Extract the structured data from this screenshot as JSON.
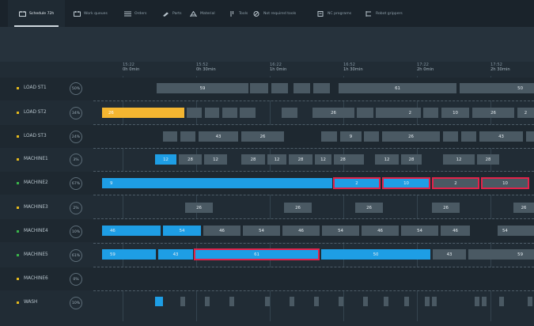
{
  "tabs": [
    {
      "label": "Schedule 72h",
      "icon": "calendar-icon",
      "active": true
    },
    {
      "label": "Work queues",
      "icon": "calendar-icon"
    },
    {
      "label": "Orders",
      "icon": "list-icon"
    },
    {
      "label": "Parts",
      "icon": "wrench-icon"
    },
    {
      "label": "Material",
      "icon": "material-icon"
    },
    {
      "label": "Tools",
      "icon": "tool-icon"
    },
    {
      "label": "Not required tools",
      "icon": "block-icon"
    },
    {
      "label": "NC programs",
      "icon": "nc-program-icon"
    },
    {
      "label": "Robot grippers",
      "icon": "gripper-icon"
    }
  ],
  "time_ticks": [
    {
      "clock": "15:22",
      "offset": "0h 0min"
    },
    {
      "clock": "15:52",
      "offset": "0h 30min"
    },
    {
      "clock": "16:22",
      "offset": "1h 0min"
    },
    {
      "clock": "16:52",
      "offset": "1h 30min"
    },
    {
      "clock": "17:22",
      "offset": "2h 0min"
    },
    {
      "clock": "17:52",
      "offset": "2h 30min"
    }
  ],
  "rows": [
    {
      "label": "LOAD ST1",
      "percent": "50%",
      "bullet": "yellow"
    },
    {
      "label": "LOAD ST2",
      "percent": "34%",
      "bullet": "yellow"
    },
    {
      "label": "LOAD ST3",
      "percent": "24%",
      "bullet": "yellow"
    },
    {
      "label": "MACHINE1",
      "percent": "3%",
      "bullet": "yellow"
    },
    {
      "label": "MACHINE2",
      "percent": "67%",
      "bullet": "green"
    },
    {
      "label": "MACHINE3",
      "percent": "2%",
      "bullet": "yellow"
    },
    {
      "label": "MACHINE4",
      "percent": "10%",
      "bullet": "green"
    },
    {
      "label": "MACHINE5",
      "percent": "61%",
      "bullet": "green"
    },
    {
      "label": "MACHINE6",
      "percent": "0%",
      "bullet": "yellow"
    },
    {
      "label": "WASH",
      "percent": "10%",
      "bullet": "yellow"
    }
  ],
  "blocks": {
    "r0": [
      "59",
      "61",
      "50"
    ],
    "r1": [
      "26",
      "26",
      "2",
      "10",
      "26",
      "2"
    ],
    "r2": [
      "43",
      "26",
      "9",
      "26",
      "43"
    ],
    "r3": [
      "12",
      "28",
      "12",
      "28",
      "12",
      "28",
      "12",
      "28",
      "12",
      "28",
      "12",
      "28"
    ],
    "r4": [
      "9",
      "2",
      "10",
      "2",
      "10"
    ],
    "r5": [
      "26",
      "26",
      "26",
      "26",
      "26"
    ],
    "r6": [
      "46",
      "54",
      "46",
      "54",
      "46",
      "54",
      "46",
      "54",
      "46",
      "54"
    ],
    "r7": [
      "59",
      "43",
      "61",
      "50",
      "43",
      "59"
    ]
  },
  "colors": {
    "background": "#212c35",
    "grey_block": "#4a5963",
    "blue_block": "#1e9ee5",
    "yellow_block": "#f4b631",
    "highlight": "#e2234a",
    "bullet_yellow": "#e4b91c",
    "bullet_green": "#3ab54a"
  }
}
